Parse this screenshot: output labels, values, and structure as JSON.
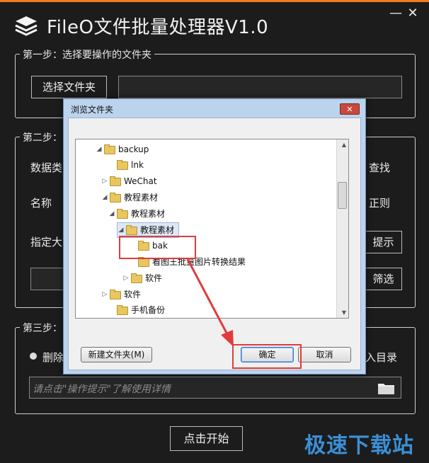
{
  "app": {
    "title": "FileO文件批量处理器V1.0",
    "logo_icon": "stack-layers-icon",
    "min_label": "—",
    "close_label": "✕",
    "accent_color": "#f07a1e"
  },
  "step1": {
    "legend": "第一步：选择要操作的文件夹",
    "choose_button": "选择文件夹",
    "folder_path": ""
  },
  "step2": {
    "legend": "第二步：",
    "data_type_label": "数据类",
    "search_label": "查找",
    "name_label": "名称",
    "regex_label": "正则",
    "size_label": "指定大",
    "hint_button": "提示",
    "filter_button": "筛选"
  },
  "step3": {
    "legend": "第三步：",
    "delete_label": "删除",
    "target_dir_label": "入目录",
    "hint_placeholder": "请点击\"操作提示\"了解使用详情"
  },
  "start_button": "点击开始",
  "watermark": "极速下载站",
  "dialog": {
    "title": "浏览文件夹",
    "close_label": "✕",
    "new_folder_button": "新建文件夹(M)",
    "ok_button": "确定",
    "cancel_button": "取消",
    "tree": [
      {
        "label": "backup",
        "expander": "◢"
      },
      {
        "label": "lnk",
        "expander": ""
      },
      {
        "label": "WeChat",
        "expander": "▷"
      },
      {
        "label": "教程素材",
        "expander": "◢"
      },
      {
        "label": "教程素材",
        "expander": "◢"
      },
      {
        "label": "教程素材",
        "expander": "◢"
      },
      {
        "label": "bak",
        "expander": ""
      },
      {
        "label": "看图王批量图片转换结果",
        "expander": ""
      },
      {
        "label": "软件",
        "expander": "▷"
      },
      {
        "label": "软件",
        "expander": "▷"
      },
      {
        "label": "手机备份",
        "expander": ""
      }
    ]
  },
  "annotation_color": "#e03c3c"
}
